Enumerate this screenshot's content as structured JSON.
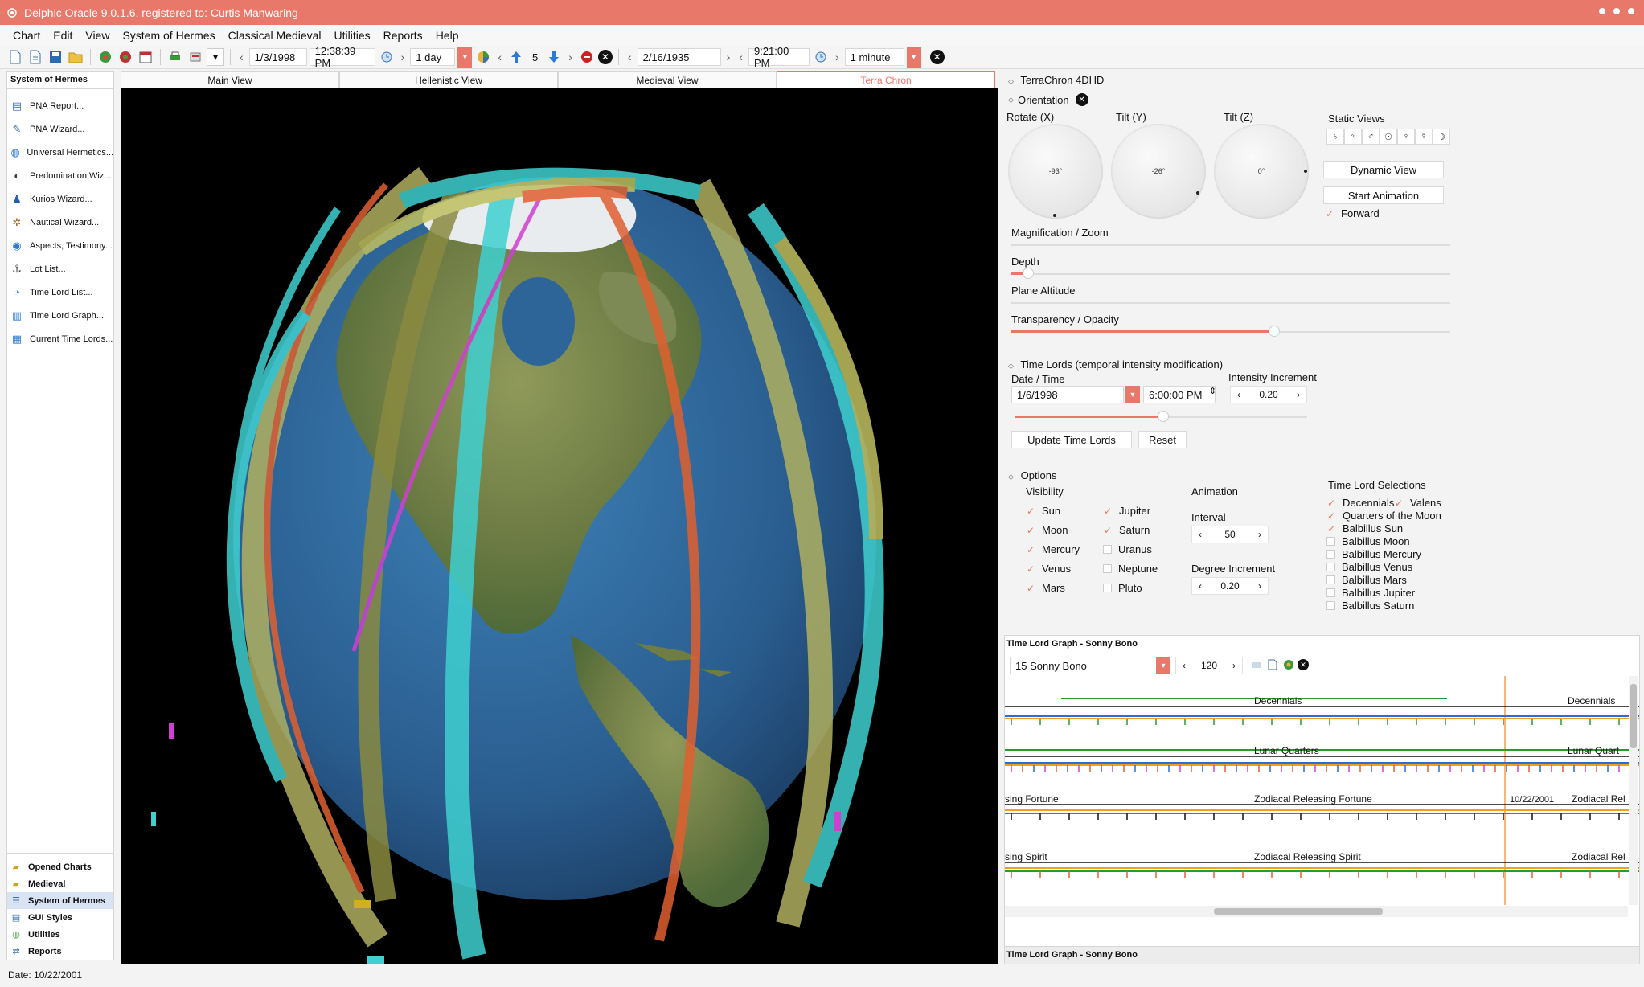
{
  "titlebar": {
    "title": "Delphic Oracle 9.0.1.6, registered to: Curtis Manwaring"
  },
  "menu": [
    "Chart",
    "Edit",
    "View",
    "System of Hermes",
    "Classical Medieval",
    "Utilities",
    "Reports",
    "Help"
  ],
  "toolbar": {
    "date1": "1/3/1998",
    "time1": "12:38:39 PM",
    "step1": "1 day",
    "count": "5",
    "date2": "2/16/1935",
    "time2": "9:21:00 PM",
    "step2": "1 minute"
  },
  "sidebar": {
    "header": "System of Hermes",
    "items": [
      {
        "label": "PNA Report...",
        "icon": "report-icon"
      },
      {
        "label": "PNA Wizard...",
        "icon": "wizard-icon"
      },
      {
        "label": "Universal Hermetics...",
        "icon": "globe-icon"
      },
      {
        "label": "Predomination Wiz...",
        "icon": "sphere-icon"
      },
      {
        "label": "Kurios Wizard...",
        "icon": "person-icon"
      },
      {
        "label": "Nautical Wizard...",
        "icon": "wheel-icon"
      },
      {
        "label": "Aspects, Testimony...",
        "icon": "eye-icon"
      },
      {
        "label": "Lot List...",
        "icon": "anchor-icon"
      },
      {
        "label": "Time Lord List...",
        "icon": "clock-icon"
      },
      {
        "label": "Time Lord Graph...",
        "icon": "graph-icon"
      },
      {
        "label": "Current Time Lords...",
        "icon": "calendar-icon"
      }
    ],
    "sections": [
      {
        "label": "Opened Charts",
        "active": false
      },
      {
        "label": "Medieval",
        "active": false
      },
      {
        "label": "System of Hermes",
        "active": true
      },
      {
        "label": "GUI Styles",
        "active": false
      },
      {
        "label": "Utilities",
        "active": false
      },
      {
        "label": "Reports",
        "active": false
      }
    ]
  },
  "tabs": [
    {
      "label": "Main View",
      "active": false
    },
    {
      "label": "Hellenistic View",
      "active": false
    },
    {
      "label": "Medieval View",
      "active": false
    },
    {
      "label": "Terra Chron",
      "active": true
    }
  ],
  "panel": {
    "header": "TerraChron 4DHD",
    "orientation": "Orientation",
    "rotate_label": "Rotate (X)",
    "tilty_label": "Tilt (Y)",
    "tiltz_label": "Tilt (Z)",
    "rotate_val": "-93°",
    "tilty_val": "-26°",
    "tiltz_val": "0°",
    "static_views": "Static Views",
    "static_glyphs": [
      "♄",
      "♃",
      "♂",
      "☉",
      "♀",
      "☿",
      "☽"
    ],
    "dynamic_view": "Dynamic View",
    "start_animation": "Start Animation",
    "forward": "Forward",
    "magnification": "Magnification / Zoom",
    "depth": "Depth",
    "plane_altitude": "Plane Altitude",
    "transparency": "Transparency / Opacity",
    "timelords_header": "Time Lords (temporal intensity modification)",
    "datetime_label": "Date / Time",
    "date_value": "1/6/1998",
    "time_value": "6:00:00 PM",
    "intensity_label": "Intensity Increment",
    "intensity_value": "0.20",
    "update_button": "Update Time Lords",
    "reset_button": "Reset",
    "options_header": "Options",
    "visibility_label": "Visibility",
    "visibility": [
      {
        "label": "Sun",
        "checked": true
      },
      {
        "label": "Moon",
        "checked": true
      },
      {
        "label": "Mercury",
        "checked": true
      },
      {
        "label": "Venus",
        "checked": true
      },
      {
        "label": "Mars",
        "checked": true
      },
      {
        "label": "Jupiter",
        "checked": true
      },
      {
        "label": "Saturn",
        "checked": true
      },
      {
        "label": "Uranus",
        "checked": false
      },
      {
        "label": "Neptune",
        "checked": false
      },
      {
        "label": "Pluto",
        "checked": false
      }
    ],
    "animation_label": "Animation",
    "interval_label": "Interval",
    "interval_value": "50",
    "degree_label": "Degree Increment",
    "degree_value": "0.20",
    "tl_selections_label": "Time Lord Selections",
    "tl_selections": [
      {
        "label": "Decennials",
        "checked": true
      },
      {
        "label": "Valens",
        "checked": true
      },
      {
        "label": "Quarters of the Moon",
        "checked": true
      },
      {
        "label": "Balbillus Sun",
        "checked": true
      },
      {
        "label": "Balbillus Moon",
        "checked": false
      },
      {
        "label": "Balbillus Mercury",
        "checked": false
      },
      {
        "label": "Balbillus Venus",
        "checked": false
      },
      {
        "label": "Balbillus Mars",
        "checked": false
      },
      {
        "label": "Balbillus Jupiter",
        "checked": false
      },
      {
        "label": "Balbillus Saturn",
        "checked": false
      }
    ]
  },
  "graph": {
    "title": "Time Lord Graph - Sonny Bono",
    "chart_select": "15 Sonny Bono",
    "zoom_value": "120",
    "footer": "Time Lord Graph - Sonny Bono",
    "date_marker": "10/22/2001",
    "row_labels": [
      {
        "left": "",
        "center": "Decennials",
        "right": "Decennials"
      },
      {
        "left": "",
        "center": "Lunar Quarters",
        "right": "Lunar Quart"
      },
      {
        "left": "sing Fortune",
        "center": "Zodiacal Releasing Fortune",
        "right": "Zodiacal Rel"
      },
      {
        "left": "sing Spirit",
        "center": "Zodiacal Releasing Spirit",
        "right": "Zodiacal Rel"
      }
    ]
  },
  "status": {
    "text": "Date: 10/22/2001"
  },
  "colors": {
    "accent": "#e8786a",
    "ocean": "#2f6a9a",
    "teal_band": "#3fd0d0",
    "orange_band": "#e06030",
    "olive_band": "#b0b060",
    "magenta_band": "#d040d0"
  }
}
